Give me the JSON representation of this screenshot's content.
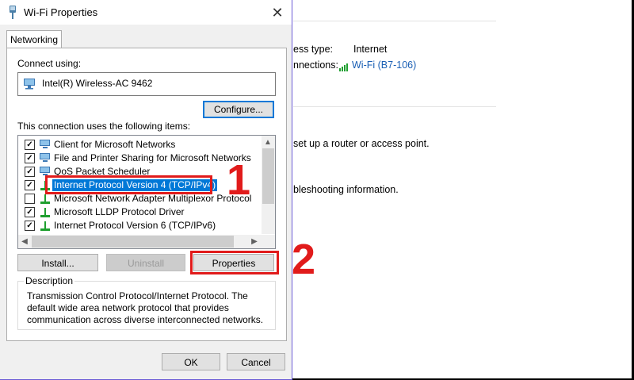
{
  "dialog": {
    "title": "Wi-Fi Properties",
    "tab": "Networking",
    "connect_using_label": "Connect using:",
    "adapter_name": "Intel(R) Wireless-AC 9462",
    "configure_label": "Configure...",
    "items_label": "This connection uses the following items:",
    "items": [
      {
        "label": "Client for Microsoft Networks",
        "checked": true,
        "icon": "client-icon"
      },
      {
        "label": "File and Printer Sharing for Microsoft Networks",
        "checked": true,
        "icon": "sharing-icon"
      },
      {
        "label": "QoS Packet Scheduler",
        "checked": true,
        "icon": "scheduler-icon"
      },
      {
        "label": "Internet Protocol Version 4 (TCP/IPv4)",
        "checked": true,
        "icon": "protocol-icon",
        "selected": true
      },
      {
        "label": "Microsoft Network Adapter Multiplexor Protocol",
        "checked": false,
        "icon": "protocol-icon"
      },
      {
        "label": "Microsoft LLDP Protocol Driver",
        "checked": true,
        "icon": "protocol-icon"
      },
      {
        "label": "Internet Protocol Version 6 (TCP/IPv6)",
        "checked": true,
        "icon": "protocol-icon"
      }
    ],
    "install_label": "Install...",
    "uninstall_label": "Uninstall",
    "properties_label": "Properties",
    "description_legend": "Description",
    "description_text": "Transmission Control Protocol/Internet Protocol. The default wide area network protocol that provides communication across diverse interconnected networks.",
    "ok_label": "OK",
    "cancel_label": "Cancel"
  },
  "background": {
    "access_type_label": "ess type:",
    "access_type_value": "Internet",
    "connections_label": "nnections:",
    "connections_value": "Wi-Fi (B7-106)",
    "router_text": "set up a router or access point.",
    "troubleshoot_text": "bleshooting information."
  },
  "annotations": {
    "step1": "1",
    "step2": "2"
  },
  "colors": {
    "selection": "#0078d7",
    "annotation": "#e11b1b",
    "link": "#1a5fb4"
  }
}
